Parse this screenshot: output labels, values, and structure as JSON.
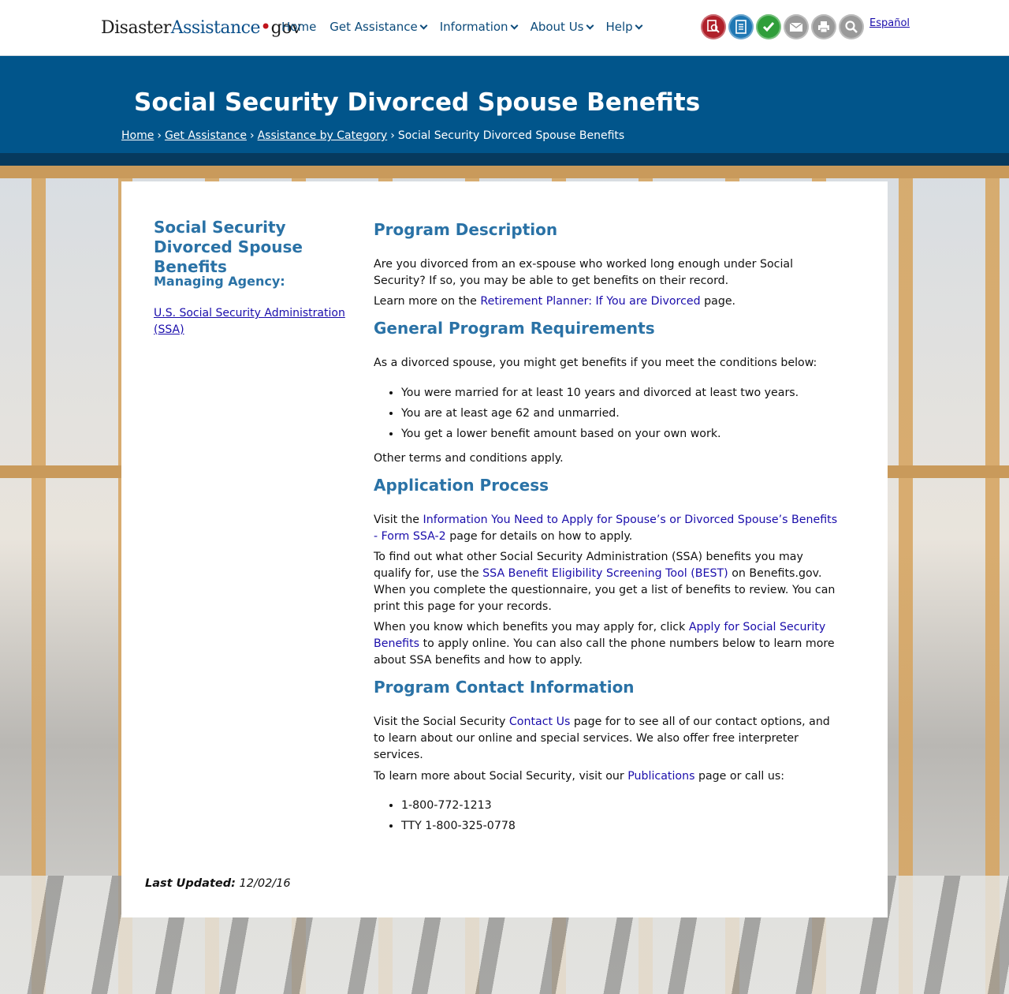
{
  "site": {
    "logo_part1": "Disaster",
    "logo_part2": "Assistance",
    "logo_part3": "gov",
    "nav": [
      {
        "label": "Home",
        "dropdown": false
      },
      {
        "label": "Get Assistance",
        "dropdown": true
      },
      {
        "label": "Information",
        "dropdown": true
      },
      {
        "label": "About Us",
        "dropdown": true
      },
      {
        "label": "Help",
        "dropdown": true
      }
    ],
    "icons": [
      {
        "name": "find-assistance-icon",
        "color": "#b0202a"
      },
      {
        "name": "apply-online-icon",
        "color": "#1f78b4"
      },
      {
        "name": "check-status-icon",
        "color": "#2f9e3a"
      },
      {
        "name": "email-icon",
        "color": "#9a9a9a"
      },
      {
        "name": "print-icon",
        "color": "#9a9a9a"
      },
      {
        "name": "search-icon",
        "color": "#9a9a9a"
      }
    ],
    "language_link": "Español"
  },
  "banner": {
    "title": "Social Security Divorced Spouse Benefits",
    "breadcrumbs": [
      "Home",
      "Get Assistance",
      "Assistance by Category"
    ],
    "current": "Social Security Divorced Spouse Benefits"
  },
  "sidebar": {
    "title": "Social Security Divorced Spouse Benefits",
    "agency_heading": "Managing Agency:",
    "agency_link": "U.S. Social Security Administration (SSA)"
  },
  "main": {
    "h_description": "Program Description",
    "desc_p1": "Are you divorced from an ex-spouse who worked long enough under Social Security? If so, you may be able to get benefits on their record.",
    "desc_p2_pre": "Learn more on the ",
    "desc_p2_link": "Retirement Planner: If You are Divorced",
    "desc_p2_post": " page.",
    "h_requirements": "General Program Requirements",
    "req_intro": "As a divorced spouse, you might get benefits if you meet the conditions below:",
    "req_items": [
      "You were married for at least 10 years and divorced at least two years.",
      "You are at least age 62 and unmarried.",
      "You get a lower benefit amount based on your own work."
    ],
    "req_outro": "Other terms and conditions apply.",
    "h_application": "Application Process",
    "app_p1_pre": "Visit the ",
    "app_p1_link": "Information You Need to Apply for Spouse’s or Divorced Spouse’s Benefits - Form SSA-2",
    "app_p1_post": " page for details on how to apply.",
    "app_p2_pre": "To find out what other Social Security Administration (SSA) benefits you may qualify for, use the ",
    "app_p2_link": "SSA Benefit Eligibility Screening Tool (BEST)",
    "app_p2_post": " on Benefits.gov. When you complete the questionnaire, you get a list of benefits to review. You can print this page for your records.",
    "app_p3_pre": "When you know which benefits you may apply for, click ",
    "app_p3_link": "Apply for Social Security Benefits",
    "app_p3_post": " to apply online. You can also call the phone numbers below to learn more about SSA benefits and how to apply.",
    "h_contact": "Program Contact Information",
    "con_p1_pre": "Visit the Social Security ",
    "con_p1_link": "Contact Us",
    "con_p1_post": " page for to see all of our contact options, and to learn about our online and special services. We also offer free interpreter services.",
    "con_p2_pre": "To learn more about Social Security, visit our ",
    "con_p2_link": "Publications",
    "con_p2_post": " page or call us:",
    "phones": [
      "1-800-772-1213",
      "TTY 1-800-325-0778"
    ]
  },
  "footer": {
    "last_updated_label": "Last Updated:",
    "last_updated_value": "12/02/16"
  }
}
